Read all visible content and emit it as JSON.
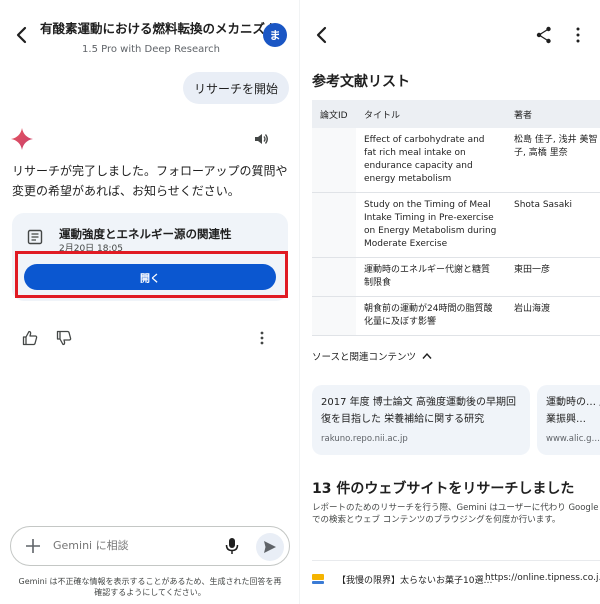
{
  "left": {
    "header": {
      "title": "有酸素運動における燃料転換のメカニズム",
      "subtitle": "1.5 Pro with Deep Research",
      "avatar_initial": "ま"
    },
    "user_message": "リサーチを開始",
    "reply": "リサーチが完了しました。フォローアップの質問や変更の希望があれば、お知らせください。",
    "doc_card": {
      "title": "運動強度とエネルギー源の関連性",
      "date": "2月20日 18:05",
      "open_label": "開く"
    },
    "input": {
      "placeholder": "Gemini に相談"
    },
    "disclaimer": "Gemini は不正確な情報を表示することがあるため、生成された回答を再確認するようにしてください。"
  },
  "right": {
    "refs_heading": "参考文献リスト",
    "table": {
      "headers": [
        "論文ID",
        "タイトル",
        "著者"
      ],
      "rows": [
        {
          "id": "",
          "title": "Effect of carbohydrate and fat rich meal intake on endurance capacity and energy metabolism",
          "author": "松島 佳子, 浅井 美智子, 高橋 里奈"
        },
        {
          "id": "",
          "title": "Study on the Timing of Meal Intake Timing in Pre-exercise on Energy Metabolism during Moderate Exercise",
          "author": "Shota Sasaki"
        },
        {
          "id": "",
          "title": "運動時のエネルギー代謝と糖質制限食",
          "author": "東田一彦"
        },
        {
          "id": "",
          "title": "朝食前の運動が24時間の脂質酸化量に及ぼす影響",
          "author": "岩山海渡"
        }
      ]
    },
    "sources_heading": "ソースと関連コンテンツ",
    "sources": [
      {
        "title": "2017 年度 博士論文 高強度運動後の早期回復を目指した 栄養補給に関する研究",
        "domain": "rakuno.repo.nii.ac.jp"
      },
      {
        "title": "運動時の… 産業振興…",
        "domain": "www.alic.g…"
      }
    ],
    "web_heading": "13 件のウェブサイトをリサーチしました",
    "web_desc": "レポートのためのリサーチを行う際、Gemini はユーザーに代わり Google での検索とウェブ コンテンツのブラウジングを何度か行います。",
    "site": {
      "title": "【我慢の限界】太らないお菓子10選…",
      "url": "https://online.tipness.co.j…"
    }
  },
  "colors": {
    "accent": "#0b57d0",
    "highlight": "#e01b24",
    "card": "#f0f4f9"
  }
}
